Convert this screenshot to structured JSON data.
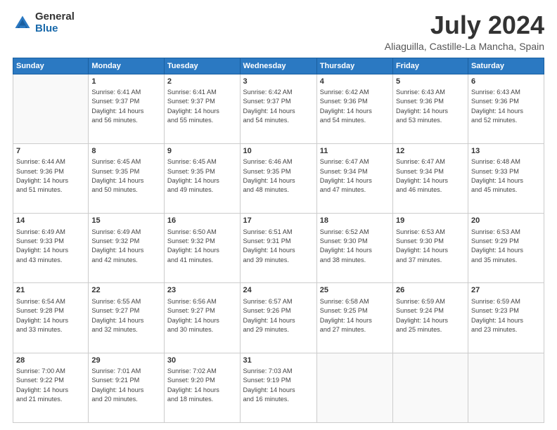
{
  "logo": {
    "general": "General",
    "blue": "Blue"
  },
  "title": "July 2024",
  "location": "Aliaguilla, Castille-La Mancha, Spain",
  "weekdays": [
    "Sunday",
    "Monday",
    "Tuesday",
    "Wednesday",
    "Thursday",
    "Friday",
    "Saturday"
  ],
  "weeks": [
    [
      {
        "day": "",
        "info": ""
      },
      {
        "day": "1",
        "info": "Sunrise: 6:41 AM\nSunset: 9:37 PM\nDaylight: 14 hours\nand 56 minutes."
      },
      {
        "day": "2",
        "info": "Sunrise: 6:41 AM\nSunset: 9:37 PM\nDaylight: 14 hours\nand 55 minutes."
      },
      {
        "day": "3",
        "info": "Sunrise: 6:42 AM\nSunset: 9:37 PM\nDaylight: 14 hours\nand 54 minutes."
      },
      {
        "day": "4",
        "info": "Sunrise: 6:42 AM\nSunset: 9:36 PM\nDaylight: 14 hours\nand 54 minutes."
      },
      {
        "day": "5",
        "info": "Sunrise: 6:43 AM\nSunset: 9:36 PM\nDaylight: 14 hours\nand 53 minutes."
      },
      {
        "day": "6",
        "info": "Sunrise: 6:43 AM\nSunset: 9:36 PM\nDaylight: 14 hours\nand 52 minutes."
      }
    ],
    [
      {
        "day": "7",
        "info": "Sunrise: 6:44 AM\nSunset: 9:36 PM\nDaylight: 14 hours\nand 51 minutes."
      },
      {
        "day": "8",
        "info": "Sunrise: 6:45 AM\nSunset: 9:35 PM\nDaylight: 14 hours\nand 50 minutes."
      },
      {
        "day": "9",
        "info": "Sunrise: 6:45 AM\nSunset: 9:35 PM\nDaylight: 14 hours\nand 49 minutes."
      },
      {
        "day": "10",
        "info": "Sunrise: 6:46 AM\nSunset: 9:35 PM\nDaylight: 14 hours\nand 48 minutes."
      },
      {
        "day": "11",
        "info": "Sunrise: 6:47 AM\nSunset: 9:34 PM\nDaylight: 14 hours\nand 47 minutes."
      },
      {
        "day": "12",
        "info": "Sunrise: 6:47 AM\nSunset: 9:34 PM\nDaylight: 14 hours\nand 46 minutes."
      },
      {
        "day": "13",
        "info": "Sunrise: 6:48 AM\nSunset: 9:33 PM\nDaylight: 14 hours\nand 45 minutes."
      }
    ],
    [
      {
        "day": "14",
        "info": "Sunrise: 6:49 AM\nSunset: 9:33 PM\nDaylight: 14 hours\nand 43 minutes."
      },
      {
        "day": "15",
        "info": "Sunrise: 6:49 AM\nSunset: 9:32 PM\nDaylight: 14 hours\nand 42 minutes."
      },
      {
        "day": "16",
        "info": "Sunrise: 6:50 AM\nSunset: 9:32 PM\nDaylight: 14 hours\nand 41 minutes."
      },
      {
        "day": "17",
        "info": "Sunrise: 6:51 AM\nSunset: 9:31 PM\nDaylight: 14 hours\nand 39 minutes."
      },
      {
        "day": "18",
        "info": "Sunrise: 6:52 AM\nSunset: 9:30 PM\nDaylight: 14 hours\nand 38 minutes."
      },
      {
        "day": "19",
        "info": "Sunrise: 6:53 AM\nSunset: 9:30 PM\nDaylight: 14 hours\nand 37 minutes."
      },
      {
        "day": "20",
        "info": "Sunrise: 6:53 AM\nSunset: 9:29 PM\nDaylight: 14 hours\nand 35 minutes."
      }
    ],
    [
      {
        "day": "21",
        "info": "Sunrise: 6:54 AM\nSunset: 9:28 PM\nDaylight: 14 hours\nand 33 minutes."
      },
      {
        "day": "22",
        "info": "Sunrise: 6:55 AM\nSunset: 9:27 PM\nDaylight: 14 hours\nand 32 minutes."
      },
      {
        "day": "23",
        "info": "Sunrise: 6:56 AM\nSunset: 9:27 PM\nDaylight: 14 hours\nand 30 minutes."
      },
      {
        "day": "24",
        "info": "Sunrise: 6:57 AM\nSunset: 9:26 PM\nDaylight: 14 hours\nand 29 minutes."
      },
      {
        "day": "25",
        "info": "Sunrise: 6:58 AM\nSunset: 9:25 PM\nDaylight: 14 hours\nand 27 minutes."
      },
      {
        "day": "26",
        "info": "Sunrise: 6:59 AM\nSunset: 9:24 PM\nDaylight: 14 hours\nand 25 minutes."
      },
      {
        "day": "27",
        "info": "Sunrise: 6:59 AM\nSunset: 9:23 PM\nDaylight: 14 hours\nand 23 minutes."
      }
    ],
    [
      {
        "day": "28",
        "info": "Sunrise: 7:00 AM\nSunset: 9:22 PM\nDaylight: 14 hours\nand 21 minutes."
      },
      {
        "day": "29",
        "info": "Sunrise: 7:01 AM\nSunset: 9:21 PM\nDaylight: 14 hours\nand 20 minutes."
      },
      {
        "day": "30",
        "info": "Sunrise: 7:02 AM\nSunset: 9:20 PM\nDaylight: 14 hours\nand 18 minutes."
      },
      {
        "day": "31",
        "info": "Sunrise: 7:03 AM\nSunset: 9:19 PM\nDaylight: 14 hours\nand 16 minutes."
      },
      {
        "day": "",
        "info": ""
      },
      {
        "day": "",
        "info": ""
      },
      {
        "day": "",
        "info": ""
      }
    ]
  ]
}
